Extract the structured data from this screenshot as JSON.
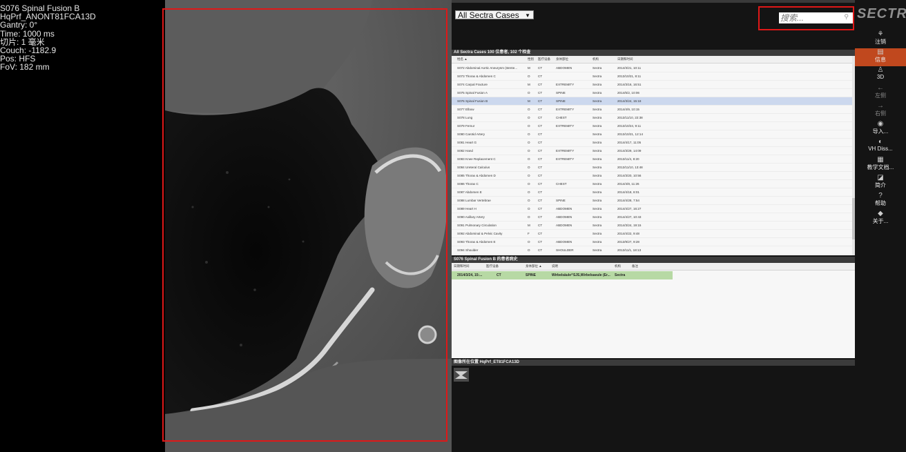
{
  "viewer": {
    "overlay": [
      "S076 Spinal Fusion B",
      "HqPrf_ANONT81FCA13D",
      "Gantry: 0°",
      "Time: 1000 ms",
      "切片: 1 毫米",
      "Couch: -1182.9",
      "Pos: HFS",
      "FoV: 182 mm"
    ]
  },
  "panel": {
    "collection": "All Sectra Cases",
    "search_placeholder": "搜索...",
    "brand": "SECTRA",
    "cases_header": "All Sectra Cases    100 位患者, 102 个检查",
    "columns": [
      "姓名 ▲",
      "性别",
      "医疗设备",
      "身体部位",
      "机构",
      "日期和时间"
    ],
    "rows": [
      [
        "S072 Abdominal Aortic Aneurysm (stente...",
        "M",
        "CT",
        "ABDOMEN",
        "Sectra",
        "2014/3/21, 10:11"
      ],
      [
        "S073 Thorax & Abdomen C",
        "O",
        "CT",
        "",
        "Sectra",
        "2013/10/21, 8:11"
      ],
      [
        "S074 Carpal Fracture",
        "M",
        "CT",
        "EXTREMITY",
        "Sectra",
        "2014/3/16, 16:51"
      ],
      [
        "S075 Spinal Fusion A",
        "O",
        "CT",
        "SPINE",
        "Sectra",
        "2014/5/2, 10:06"
      ],
      [
        "S076 Spinal Fusion B",
        "M",
        "CT",
        "SPINE",
        "Sectra",
        "2014/3/24, 15:18"
      ],
      [
        "S077 Elbow",
        "O",
        "CT",
        "EXTREMITY",
        "Sectra",
        "2014/4/9, 10:15"
      ],
      [
        "S078 Lung",
        "O",
        "CT",
        "CHEST",
        "Sectra",
        "2013/11/10, 22:38"
      ],
      [
        "S079 Femur",
        "O",
        "CT",
        "EXTREMITY",
        "Sectra",
        "2013/10/24, 9:11"
      ],
      [
        "S080 Carotid Artery",
        "O",
        "CT",
        "",
        "Sectra",
        "2013/10/21, 12:14"
      ],
      [
        "S081 Heart G",
        "O",
        "CT",
        "",
        "Sectra",
        "2014/4/17, 11:05"
      ],
      [
        "S082 Hand",
        "O",
        "CT",
        "EXTREMITY",
        "Sectra",
        "2014/3/29, 14:09"
      ],
      [
        "S083 Knee Replacement C",
        "O",
        "CT",
        "EXTREMITY",
        "Sectra",
        "2013/11/4, 8:20"
      ],
      [
        "S084 Ureteral Calculus",
        "O",
        "CT",
        "",
        "Sectra",
        "2013/11/10, 13:48"
      ],
      [
        "S085 Thorax & Abdomen D",
        "O",
        "CT",
        "",
        "Sectra",
        "2014/3/20, 10:56"
      ],
      [
        "S086 Thorax C",
        "O",
        "CT",
        "CHEST",
        "Sectra",
        "2014/4/8, 11:26"
      ],
      [
        "S087 Abdomen E",
        "O",
        "CT",
        "",
        "Sectra",
        "2014/4/18, 8:01"
      ],
      [
        "S088 Lumbar Vertebrae",
        "O",
        "CT",
        "SPINE",
        "Sectra",
        "2014/4/28, 7:54"
      ],
      [
        "S089 Heart H",
        "O",
        "CT",
        "ABDOMEN",
        "Sectra",
        "2014/4/27, 16:27"
      ],
      [
        "S090 Axillary Artery",
        "O",
        "CT",
        "ABDOMEN",
        "Sectra",
        "2014/4/27, 10:43"
      ],
      [
        "S091 Pulmonary Circulation",
        "M",
        "CT",
        "ABDOMEN",
        "Sectra",
        "2014/3/24, 19:15"
      ],
      [
        "S092 Abdominal & Pelvic Cavity",
        "F",
        "CT",
        "",
        "Sectra",
        "2014/4/22, 9:48"
      ],
      [
        "S093 Thorax & Abdomen E",
        "O",
        "CT",
        "ABDOMEN",
        "Sectra",
        "2013/9/27, 9:28"
      ],
      [
        "S094 Shoulder",
        "O",
        "CT",
        "SHOULDER",
        "Sectra",
        "2013/11/1, 18:13"
      ],
      [
        "S095 Thorax D",
        "O",
        "CT",
        "CHEST",
        "Sectra",
        "2013/10/24, 8:30"
      ]
    ],
    "selected_row": 4,
    "studies_header": "S076 Spinal Fusion B 的患者病史",
    "studies_columns": [
      "日期和时间",
      "医疗设备",
      "身体部位 ▲",
      "说明",
      "机构",
      "备注"
    ],
    "study": {
      "date": "2014/3/24, 15:...",
      "device": "CT",
      "body": "SPINE",
      "desc": "Wirbelsäule^SJS,Wirbelsaeule (Er...",
      "inst": "Sectra"
    },
    "series_header": "图像所在位置 HqPrf_ET81FCA13D"
  },
  "toolbar": [
    {
      "label": "注销",
      "icon": "logout-icon",
      "glyph": "⚘",
      "active": false,
      "dim": false
    },
    {
      "label": "信息",
      "icon": "info-icon",
      "glyph": "▤",
      "active": true,
      "dim": false
    },
    {
      "label": "3D",
      "icon": "3d-person-icon",
      "glyph": "♙",
      "active": false,
      "dim": false
    },
    {
      "label": "左侧",
      "icon": "arrow-left-icon",
      "glyph": "←",
      "active": false,
      "dim": true
    },
    {
      "label": "右侧",
      "icon": "arrow-right-icon",
      "glyph": "→",
      "active": false,
      "dim": true
    },
    {
      "label": "导入...",
      "icon": "import-icon",
      "glyph": "◉",
      "active": false,
      "dim": false
    },
    {
      "label": "VH Diss...",
      "icon": "vh-dissection-icon",
      "glyph": "◐",
      "active": false,
      "dim": false
    },
    {
      "label": "教学文档...",
      "icon": "teaching-docs-icon",
      "glyph": "▦",
      "active": false,
      "dim": false
    },
    {
      "label": "简介",
      "icon": "intro-book-icon",
      "glyph": "◪",
      "active": false,
      "dim": false
    },
    {
      "label": "帮助",
      "icon": "help-icon",
      "glyph": "?",
      "active": false,
      "dim": false
    },
    {
      "label": "关于...",
      "icon": "about-icon",
      "glyph": "◆",
      "active": false,
      "dim": false
    }
  ],
  "colors": {
    "accent": "#c0481e",
    "highlight_frame": "#e01818",
    "selected_row": "#ccd8ee",
    "study_row": "#b7d9a4"
  }
}
